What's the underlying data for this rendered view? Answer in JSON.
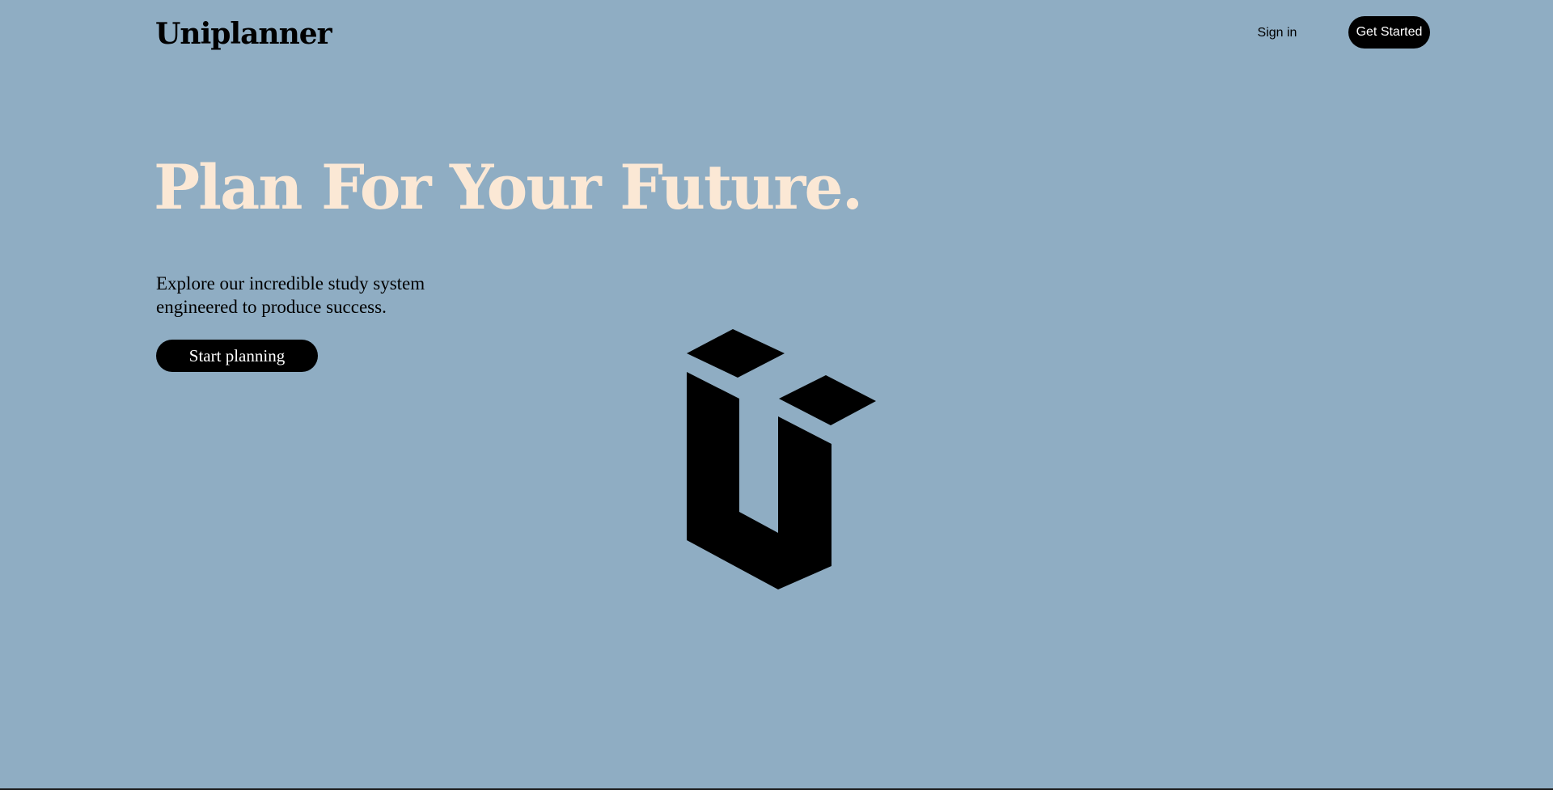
{
  "header": {
    "brand": "Uniplanner",
    "sign_in_label": "Sign in",
    "get_started_label": "Get Started"
  },
  "hero": {
    "headline": "Plan For Your Future.",
    "subtext": "Explore our incredible study system engineered to produce success.",
    "cta_label": "Start planning"
  },
  "logo": {
    "icon": "uniplanner-u-logo-icon"
  },
  "colors": {
    "background": "#8fadc3",
    "headline": "#fbe8d5",
    "button": "#000000",
    "button_text": "#ffffff"
  }
}
